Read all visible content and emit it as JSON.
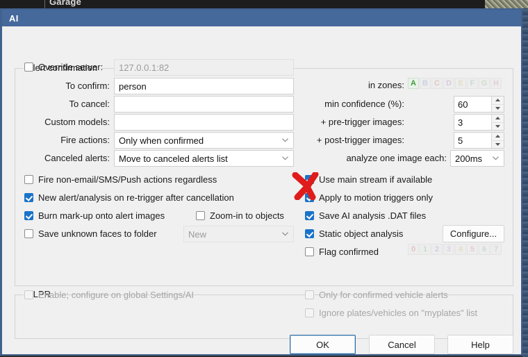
{
  "background": {
    "tab_label": "Garage"
  },
  "window": {
    "title": "AI"
  },
  "groups": {
    "alert_confirmation": {
      "legend": "Alert confirmation"
    },
    "alpr": {
      "legend": "ALPR"
    }
  },
  "alert": {
    "override_server": {
      "label": "Override server:",
      "checked": false,
      "value": "127.0.0.1:82",
      "enabled": false
    },
    "to_confirm": {
      "label": "To confirm:",
      "value": "person"
    },
    "to_cancel": {
      "label": "To cancel:",
      "value": ""
    },
    "custom_models": {
      "label": "Custom models:",
      "value": ""
    },
    "fire_actions": {
      "label": "Fire actions:",
      "value": "Only when confirmed"
    },
    "canceled_alerts": {
      "label": "Canceled alerts:",
      "value": "Move to canceled alerts list"
    },
    "in_zones": {
      "label": "in zones:",
      "zones": [
        "A",
        "B",
        "C",
        "D",
        "E",
        "F",
        "G",
        "H"
      ],
      "active": [
        "A"
      ]
    },
    "min_confidence": {
      "label": "min confidence (%):",
      "value": "60"
    },
    "pre_trigger_images": {
      "label": "+ pre-trigger images:",
      "value": "3"
    },
    "post_trigger_images": {
      "label": "+ post-trigger images:",
      "value": "5"
    },
    "analyze_one_image_each": {
      "label": "analyze one image each:",
      "value": "200ms"
    },
    "checkboxes_left": [
      {
        "label": "Fire non-email/SMS/Push actions regardless",
        "checked": false
      },
      {
        "label": "New alert/analysis on re-trigger after cancellation",
        "checked": true
      },
      {
        "label": "Burn mark-up onto alert images",
        "checked": true
      },
      {
        "label": "Zoom-in to objects",
        "checked": false
      },
      {
        "label": "Save unknown faces to folder",
        "checked": false
      }
    ],
    "unknown_faces_folder": {
      "value": "New",
      "enabled": false
    },
    "checkboxes_right": [
      {
        "label": "Use main stream if available",
        "checked": true
      },
      {
        "label": "Apply to motion triggers only",
        "checked": true
      },
      {
        "label": "Save AI analysis .DAT files",
        "checked": true
      },
      {
        "label": "Static object analysis",
        "checked": true
      },
      {
        "label": "Flag confirmed",
        "checked": false
      }
    ],
    "configure_button": "Configure...",
    "flag_confirmed_digits": [
      "0",
      "1",
      "2",
      "3",
      "4",
      "5",
      "6",
      "7"
    ]
  },
  "alpr": {
    "enable": {
      "label": "Enable; configure on global Settings/AI",
      "checked": false
    },
    "only_confirmed": {
      "label": "Only for confirmed vehicle alerts",
      "checked": false
    },
    "ignore_plates": {
      "label": "Ignore plates/vehicles on \"myplates\" list",
      "checked": false
    }
  },
  "footer": {
    "ok": "OK",
    "cancel": "Cancel",
    "help": "Help"
  },
  "annotation": {
    "mark": "red-x",
    "color": "#e01b1b"
  }
}
